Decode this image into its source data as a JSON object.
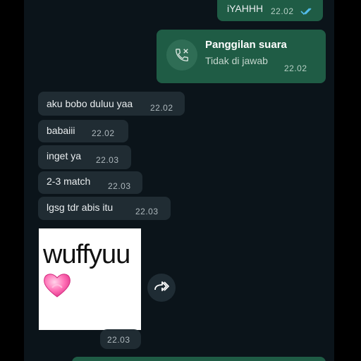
{
  "messages": {
    "top_out": {
      "text": "iYAHHH",
      "time": "22.02",
      "status": "read"
    },
    "call": {
      "title": "Panggilan suara",
      "subtitle": "Tidak di jawab",
      "time": "22.02",
      "icon": "missed-call-icon"
    },
    "in": [
      {
        "text": "aku bobo duluu yaa",
        "time": "22.02"
      },
      {
        "text": "babaiii",
        "time": "22.02"
      },
      {
        "text": "inget ya",
        "time": "22.03"
      },
      {
        "text": "2-3 match",
        "time": "22.03"
      },
      {
        "text": "lgsg tdr abis itu",
        "time": "22.03"
      }
    ],
    "sticker": {
      "text": "wuffyuu",
      "emoji": "heart-icon",
      "time": "22.03"
    }
  },
  "colors": {
    "background": "#0b141a",
    "incoming_bubble": "#202c33",
    "outgoing_bubble": "#1f5c45",
    "read_ticks": "#53bdeb"
  }
}
